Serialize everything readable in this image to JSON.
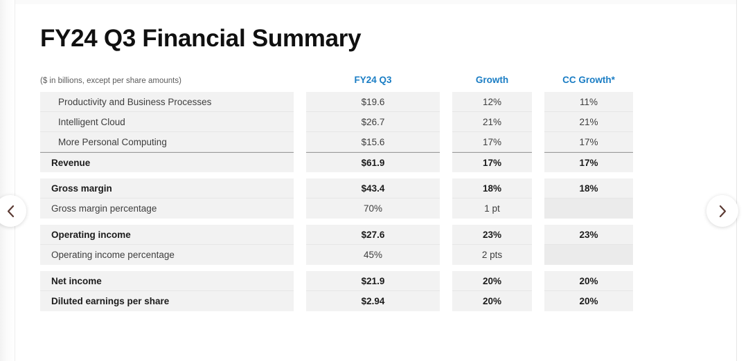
{
  "page": {
    "title": "FY24 Q3 Financial Summary",
    "units_note": "($ in billions, except per share amounts)"
  },
  "columns": {
    "label": "",
    "value": "FY24 Q3",
    "growth": "Growth",
    "cc_growth": "CC Growth*"
  },
  "accent_color": "#1a7dc4",
  "nav": {
    "prev_icon": "chevron-left-icon",
    "next_icon": "chevron-right-icon"
  },
  "groups": [
    {
      "rows": [
        {
          "label": "Productivity and Business Processes",
          "value": "$19.6",
          "growth": "12%",
          "cc_growth": "11%",
          "bold": false,
          "indent": true
        },
        {
          "label": "Intelligent Cloud",
          "value": "$26.7",
          "growth": "21%",
          "cc_growth": "21%",
          "bold": false,
          "indent": true
        },
        {
          "label": "More Personal Computing",
          "value": "$15.6",
          "growth": "17%",
          "cc_growth": "17%",
          "bold": false,
          "indent": true
        },
        {
          "label": "Revenue",
          "value": "$61.9",
          "growth": "17%",
          "cc_growth": "17%",
          "bold": true,
          "indent": false,
          "topline": true
        }
      ]
    },
    {
      "rows": [
        {
          "label": "Gross margin",
          "value": "$43.4",
          "growth": "18%",
          "cc_growth": "18%",
          "bold": true,
          "indent": false
        },
        {
          "label": "Gross margin percentage",
          "value": "70%",
          "growth": "1 pt",
          "cc_growth": "",
          "bold": false,
          "indent": false
        }
      ]
    },
    {
      "rows": [
        {
          "label": "Operating income",
          "value": "$27.6",
          "growth": "23%",
          "cc_growth": "23%",
          "bold": true,
          "indent": false
        },
        {
          "label": "Operating income percentage",
          "value": "45%",
          "growth": "2 pts",
          "cc_growth": "",
          "bold": false,
          "indent": false
        }
      ]
    },
    {
      "rows": [
        {
          "label": "Net income",
          "value": "$21.9",
          "growth": "20%",
          "cc_growth": "20%",
          "bold": true,
          "indent": false
        },
        {
          "label": "Diluted earnings per share",
          "value": "$2.94",
          "growth": "20%",
          "cc_growth": "20%",
          "bold": true,
          "indent": false
        }
      ]
    }
  ]
}
